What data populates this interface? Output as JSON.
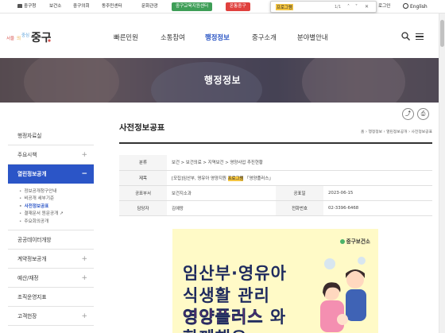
{
  "topbar": {
    "links": [
      "중구청",
      "보건소",
      "중구의회",
      "동주민센터",
      "문화관광"
    ],
    "pill_green": "중구교육지원센터",
    "pill_red": "온통중구",
    "login": "로그인",
    "english": "English"
  },
  "find_bar": {
    "query": "프로그램",
    "count": "1/1"
  },
  "gnb": [
    "빠른민원",
    "소통참여",
    "행정정보",
    "중구소개",
    "분야별안내"
  ],
  "banner": {
    "title": "행정정보"
  },
  "sidebar": {
    "items": [
      {
        "label": "행정자료실",
        "plus": ""
      },
      {
        "label": "주요시책",
        "plus": "+"
      },
      {
        "label": "열린정보공개",
        "plus": "−"
      },
      {
        "label": "공공데이터개방",
        "plus": ""
      },
      {
        "label": "계약정보공개",
        "plus": "+"
      },
      {
        "label": "예산/재정",
        "plus": "+"
      },
      {
        "label": "조직운영지표",
        "plus": ""
      },
      {
        "label": "고객헌장",
        "plus": "+"
      }
    ],
    "subitems": [
      "정보공개청구안내",
      "비공개 세부기준",
      "사전정보공표",
      "결재문서 원문공개",
      "주요회의공개"
    ]
  },
  "main": {
    "title": "사전정보공표",
    "breadcrumb": [
      "홈",
      "행정정보",
      "열린정보공개",
      "사전정보공표"
    ],
    "category_label": "분류",
    "category_value": "보건 > 보건의료 > 지역보건 > 영양사업 추진현황",
    "subject_label": "제목",
    "subject_prefix": "[모집]임산부, 영유아 영양지원 ",
    "subject_hl": "프로그램",
    "subject_suffix": " 「영양플러스」",
    "dept_label": "공표부서",
    "dept_value": "보건지소과",
    "date_label": "공표일",
    "date_value": "2023-06-15",
    "person_label": "담당자",
    "person_value": "김예랑",
    "phone_label": "전화번호",
    "phone_value": "02-3396-6468"
  },
  "poster": {
    "org": "중구보건소",
    "line1": "임산부·영유아",
    "line2": "식생활 관리",
    "line3": "영양플러스",
    "line3_suffix": " 와",
    "line4": "함께해요"
  },
  "colors": {
    "accent": "#2b55c7",
    "highlight": "#f4c542",
    "pill_green": "#3e9e57",
    "pill_red": "#e0413e"
  }
}
